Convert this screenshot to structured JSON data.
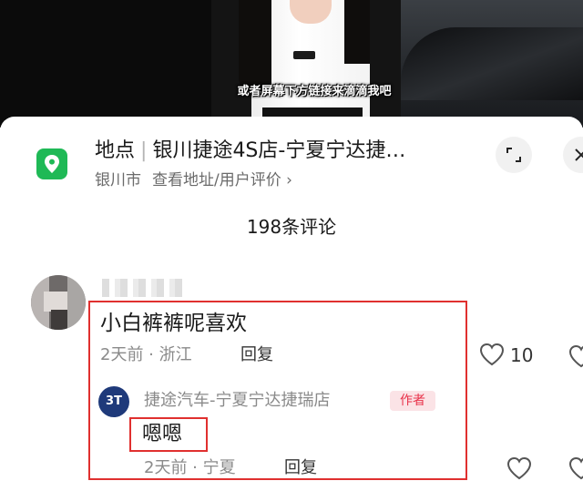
{
  "video": {
    "caption": "或者屏幕下方链接来滴滴我吧"
  },
  "location": {
    "prefix": "地点",
    "name": "银川捷途4S店-宁夏宁达捷…",
    "city": "银川市",
    "link": "查看地址/用户评价",
    "chevron": "›",
    "icon": "location-pin-icon",
    "icon_color": "#1fb956"
  },
  "header": {
    "comment_count": "198条评论"
  },
  "comment": {
    "text": "小白裤裤呢喜欢",
    "time": "2天前",
    "region": "浙江",
    "reply_label": "回复",
    "like_count": "10",
    "reply": {
      "user": "捷途汽车-宁夏宁达捷瑞店",
      "badge": "作者",
      "text": "嗯嗯",
      "time": "2天前",
      "region": "宁夏",
      "reply_label": "回复"
    }
  },
  "colors": {
    "highlight": "#e0302f",
    "badge_text": "#e8324a",
    "badge_bg": "#fbe3e6"
  }
}
